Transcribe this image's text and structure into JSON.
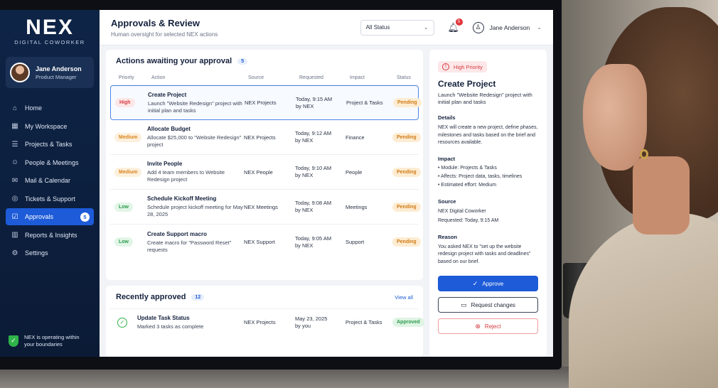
{
  "brand": {
    "logo": "NEX",
    "tagline": "DIGITAL COWORKER"
  },
  "user": {
    "name": "Jane Anderson",
    "role": "Product Manager"
  },
  "nav": [
    {
      "label": "Home",
      "icon": "home-icon"
    },
    {
      "label": "My Workspace",
      "icon": "workspace-icon"
    },
    {
      "label": "Projects & Tasks",
      "icon": "list-icon"
    },
    {
      "label": "People & Meetings",
      "icon": "people-icon"
    },
    {
      "label": "Mail & Calendar",
      "icon": "mail-icon"
    },
    {
      "label": "Tickets & Support",
      "icon": "support-icon"
    },
    {
      "label": "Approvals",
      "icon": "approvals-icon",
      "badge": "5",
      "active": true
    },
    {
      "label": "Reports & Insights",
      "icon": "chart-icon"
    },
    {
      "label": "Settings",
      "icon": "gear-icon"
    }
  ],
  "safety": {
    "text": "NEX is operating within your boundaries"
  },
  "header": {
    "title": "Approvals & Review",
    "subtitle": "Human oversight for selected NEX actions",
    "status_filter": "All Status",
    "notifications": "5",
    "user_name": "Jane Anderson"
  },
  "queue": {
    "title": "Actions awaiting your approval",
    "count": "5",
    "columns": [
      "Priority",
      "Action",
      "Source",
      "Requested",
      "Impact",
      "Status"
    ],
    "rows": [
      {
        "priority": "High",
        "level": "high",
        "title": "Create Project",
        "desc": "Launch \"Website Redesign\" project with initial plan and tasks",
        "source": "NEX Projects",
        "req1": "Today, 9:15 AM",
        "req2": "by NEX",
        "impact": "Project & Tasks",
        "status": "Pending"
      },
      {
        "priority": "Medium",
        "level": "medium",
        "title": "Allocate Budget",
        "desc": "Allocate $25,000 to \"Website Redesign\" project",
        "source": "NEX Projects",
        "req1": "Today, 9:12 AM",
        "req2": "by NEX",
        "impact": "Finance",
        "status": "Pending"
      },
      {
        "priority": "Medium",
        "level": "medium",
        "title": "Invite People",
        "desc": "Add 4 team members to Website Redesign project",
        "source": "NEX People",
        "req1": "Today, 9:10 AM",
        "req2": "by NEX",
        "impact": "People",
        "status": "Pending"
      },
      {
        "priority": "Low",
        "level": "low",
        "title": "Schedule Kickoff Meeting",
        "desc": "Schedule project kickoff meeting for May 28, 2025",
        "source": "NEX Meetings",
        "req1": "Today, 9:08 AM",
        "req2": "by NEX",
        "impact": "Meetings",
        "status": "Pending"
      },
      {
        "priority": "Low",
        "level": "low",
        "title": "Create Support macro",
        "desc": "Create macro for \"Password Reset\" requests",
        "source": "NEX Support",
        "req1": "Today, 9:05 AM",
        "req2": "by NEX",
        "impact": "Support",
        "status": "Pending"
      }
    ]
  },
  "recent": {
    "title": "Recently approved",
    "count": "12",
    "view_all": "View all",
    "rows": [
      {
        "title": "Update Task Status",
        "desc": "Marked 3 tasks as complete",
        "source": "NEX Projects",
        "req1": "May 23, 2025",
        "req2": "by you",
        "impact": "Project & Tasks",
        "status": "Approved"
      }
    ]
  },
  "detail": {
    "priority": "High Priority",
    "title": "Create Project",
    "subtitle": "Launch \"Website Redesign\" project with initial plan and tasks",
    "details_heading": "Details",
    "details_text": "NEX will create a new project, define phases, milestones and tasks based on the brief and resources available.",
    "impact_heading": "Impact",
    "impact_items": [
      "• Module: Projects & Tasks",
      "• Affects: Project data, tasks, timelines",
      "• Estimated effort: Medium"
    ],
    "source_heading": "Source",
    "source_name": "NEX Digital Coworker",
    "source_requested": "Requested: Today, 9:15 AM",
    "reason_heading": "Reason",
    "reason_text": "You asked NEX to \"set up the website redesign project with tasks and deadlines\" based on our brief.",
    "approve_label": "Approve",
    "changes_label": "Request changes",
    "reject_label": "Reject"
  }
}
